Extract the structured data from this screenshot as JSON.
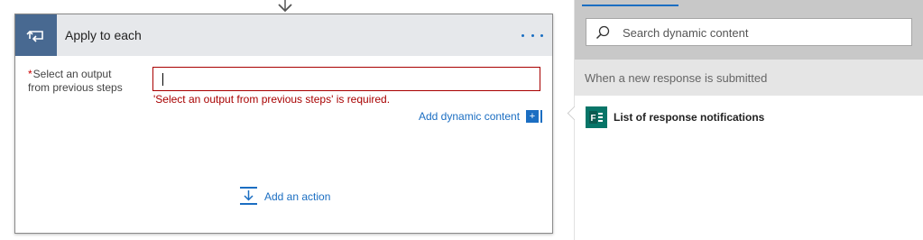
{
  "card": {
    "title": "Apply to each",
    "field_label_required": "*",
    "field_label_line1": "Select an output",
    "field_label_line2": "from previous steps",
    "field_value": "",
    "error_text": "'Select an output from previous steps' is required.",
    "add_dynamic_content": "Add dynamic content",
    "add_action": "Add an action",
    "icons": {
      "loop": "loop-icon",
      "more": "more-options-icon",
      "plus": "plus-icon",
      "add_action": "add-action-icon"
    }
  },
  "panel": {
    "search_placeholder": "Search dynamic content",
    "section_title": "When a new response is submitted",
    "items": [
      {
        "label": "List of response notifications",
        "icon": "forms-icon"
      }
    ]
  },
  "colors": {
    "accent": "#1b6ec2",
    "header_tile": "#486991",
    "error": "#a80000",
    "forms": "#077568"
  }
}
